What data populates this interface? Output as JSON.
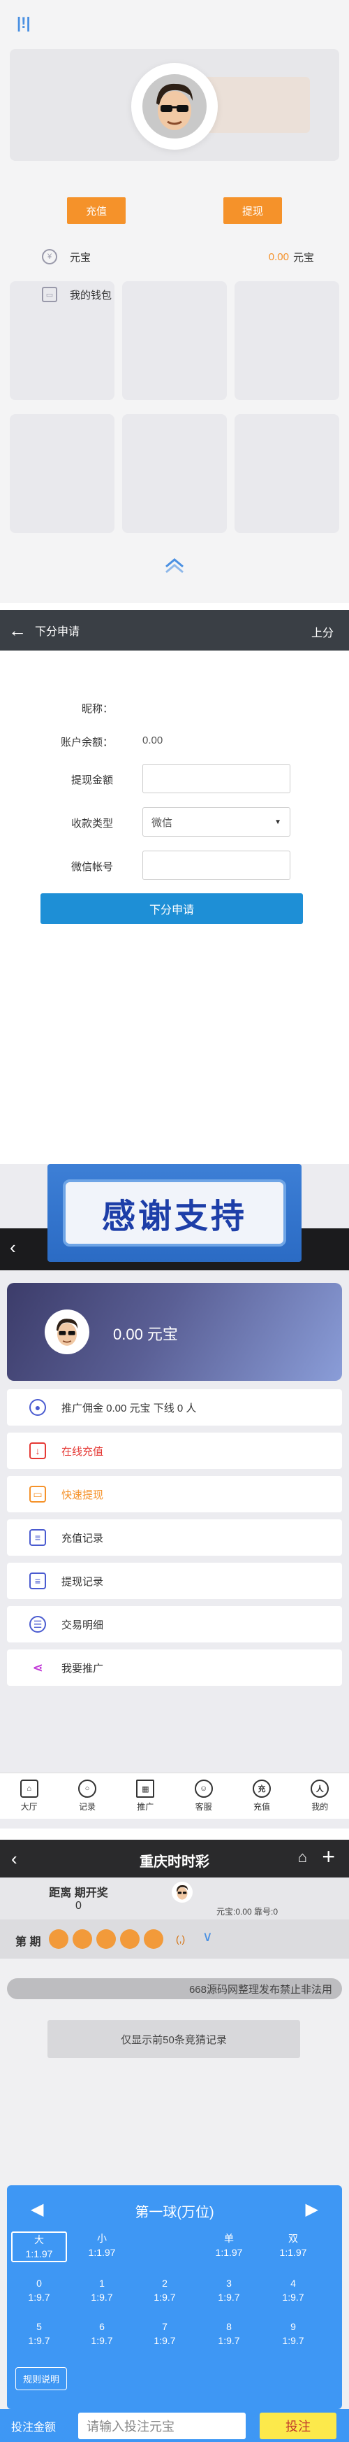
{
  "panel1": {
    "logo": "|!|",
    "recharge_label": "充值",
    "withdraw_label": "提现",
    "currency_label": "元宝",
    "balance": "0.00",
    "balance_unit": "元宝",
    "wallet_label": "我的钱包"
  },
  "panel2": {
    "title": "下分申请",
    "right_link": "上分",
    "nickname_label": "昵称：",
    "balance_label": "账户余额：",
    "balance_value": "0.00",
    "amount_label": "提现金额",
    "type_label": "收款类型",
    "type_value": "微信",
    "account_label": "微信帐号",
    "submit_label": "下分申请"
  },
  "panel3": {
    "thanks_text": "感谢支持",
    "balance_display": "0.00 元宝",
    "menu": [
      {
        "label": "推广佣金 0.00 元宝    下线 0 人",
        "icon": "user-icon",
        "color": "#333333"
      },
      {
        "label": "在线充值",
        "icon": "recharge-icon",
        "color": "#e53935"
      },
      {
        "label": "快速提现",
        "icon": "card-icon",
        "color": "#f5922a"
      },
      {
        "label": "充值记录",
        "icon": "record-icon",
        "color": "#333333"
      },
      {
        "label": "提现记录",
        "icon": "record-icon",
        "color": "#333333"
      },
      {
        "label": "交易明细",
        "icon": "database-icon",
        "color": "#333333"
      },
      {
        "label": "我要推广",
        "icon": "share-icon",
        "color": "#333333"
      }
    ],
    "nav": [
      {
        "label": "大厅",
        "icon": "store-icon"
      },
      {
        "label": "记录",
        "icon": "search-icon"
      },
      {
        "label": "推广",
        "icon": "qrcode-icon"
      },
      {
        "label": "客服",
        "icon": "service-icon"
      },
      {
        "label": "充值",
        "icon": "recharge-icon"
      },
      {
        "label": "我的",
        "icon": "person-icon"
      }
    ]
  },
  "panel4": {
    "title": "重庆时时彩",
    "countdown_label": "距离 期开奖",
    "countdown_value": "0",
    "user_info": "元宝:0.00 靠号:0",
    "period_label": "第 期",
    "period_extra": "(,)",
    "notice": "668源码网整理发布禁止非法用",
    "only50": "仅显示前50条竞猜记录",
    "pad_title": "第一球(万位)",
    "rules_label": "规则说明",
    "bet_label": "投注金额",
    "bet_placeholder": "请输入投注元宝",
    "bet_button": "投注",
    "cells": [
      {
        "name": "大",
        "odds": "1:1.97"
      },
      {
        "name": "小",
        "odds": "1:1.97"
      },
      {
        "name": "单",
        "odds": "1:1.97"
      },
      {
        "name": "双",
        "odds": "1:1.97"
      },
      {
        "name": "0",
        "odds": "1:9.7"
      },
      {
        "name": "1",
        "odds": "1:9.7"
      },
      {
        "name": "2",
        "odds": "1:9.7"
      },
      {
        "name": "3",
        "odds": "1:9.7"
      },
      {
        "name": "4",
        "odds": "1:9.7"
      },
      {
        "name": "5",
        "odds": "1:9.7"
      },
      {
        "name": "6",
        "odds": "1:9.7"
      },
      {
        "name": "7",
        "odds": "1:9.7"
      },
      {
        "name": "8",
        "odds": "1:9.7"
      },
      {
        "name": "9",
        "odds": "1:9.7"
      }
    ]
  }
}
